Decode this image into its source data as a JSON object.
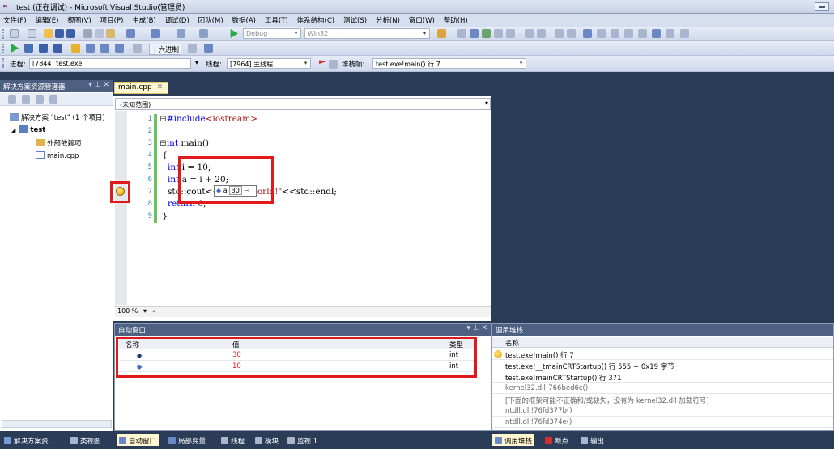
{
  "window": {
    "title": "test (正在调试) - Microsoft Visual Studio(管理员)"
  },
  "menu": [
    "文件(F)",
    "编辑(E)",
    "视图(V)",
    "项目(P)",
    "生成(B)",
    "调试(D)",
    "团队(M)",
    "数据(A)",
    "工具(T)",
    "体系结构(C)",
    "测试(S)",
    "分析(N)",
    "窗口(W)",
    "帮助(H)"
  ],
  "toolbar": {
    "config": "Debug",
    "platform": "Win32",
    "hex_label": "十六进制"
  },
  "debug_location": {
    "process_label": "进程:",
    "process": "[7844] test.exe",
    "thread_label": "线程:",
    "thread": "[7964] 主线程",
    "stack_label": "堆栈帧:",
    "stack_frame": "test.exe!main()  行 7"
  },
  "solution_explorer": {
    "title": "解决方案资源管理器",
    "items": [
      "解决方案 \"test\" (1 个项目)",
      "test",
      "外部依赖项",
      "main.cpp"
    ]
  },
  "editor": {
    "tab": "main.cpp",
    "scope": "(未知范围)",
    "line_numbers": [
      "1",
      "2",
      "3",
      "4",
      "5",
      "6",
      "7",
      "8",
      "9"
    ],
    "zoom": "100 %",
    "datatip": {
      "name": "a",
      "value": "30"
    }
  },
  "autos": {
    "title": "自动窗口",
    "headers": [
      "名称",
      "值",
      "类型"
    ],
    "rows": [
      {
        "name": "a",
        "value": "30",
        "type": "int"
      },
      {
        "name": "i",
        "value": "10",
        "type": "int"
      }
    ]
  },
  "call_stack": {
    "title": "调用堆栈",
    "header": "名称",
    "rows": [
      "test.exe!main()  行 7",
      "test.exe!__tmainCRTStartup()  行 555 + 0x19 字节",
      "test.exe!mainCRTStartup()  行 371",
      "kernel32.dll!766bed6c()",
      "[下面的框架可能不正确和/或缺失，没有为 kernel32.dll 加载符号]",
      "ntdll.dll!76fd377b()",
      "ntdll.dll!76fd374e()"
    ]
  },
  "bottom_tabs_left": [
    "解决方案资...",
    "类视图",
    "自动窗口",
    "局部变量",
    "线程",
    "模块",
    "监视 1"
  ],
  "bottom_tabs_right": [
    "调用堆栈",
    "断点",
    "输出"
  ],
  "colors": {
    "highlight_red": "#e0191b",
    "panel_title": "#4d6082",
    "chrome": "#2b3c59"
  }
}
